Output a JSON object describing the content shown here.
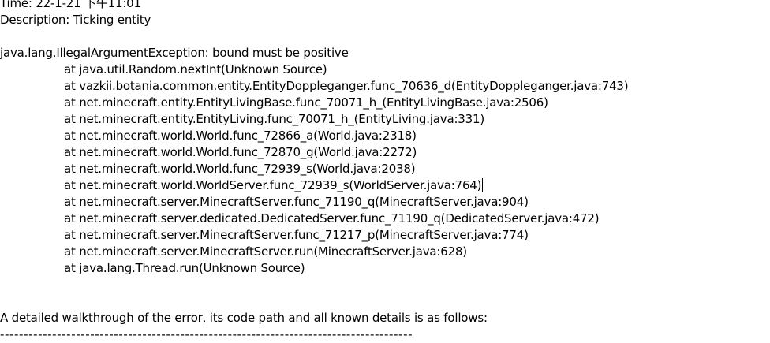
{
  "header": {
    "time": "Time: 22-1-21 下午11:01",
    "description": "Description: Ticking entity"
  },
  "exception": {
    "message": "java.lang.IllegalArgumentException: bound must be positive",
    "stack": [
      "at java.util.Random.nextInt(Unknown Source)",
      "at vazkii.botania.common.entity.EntityDoppleganger.func_70636_d(EntityDoppleganger.java:743)",
      "at net.minecraft.entity.EntityLivingBase.func_70071_h_(EntityLivingBase.java:2506)",
      "at net.minecraft.entity.EntityLiving.func_70071_h_(EntityLiving.java:331)",
      "at net.minecraft.world.World.func_72866_a(World.java:2318)",
      "at net.minecraft.world.World.func_72870_g(World.java:2272)",
      "at net.minecraft.world.World.func_72939_s(World.java:2038)",
      "at net.minecraft.world.WorldServer.func_72939_s(WorldServer.java:764)",
      "at net.minecraft.server.MinecraftServer.func_71190_q(MinecraftServer.java:904)",
      "at net.minecraft.server.dedicated.DedicatedServer.func_71190_q(DedicatedServer.java:472)",
      "at net.minecraft.server.MinecraftServer.func_71217_p(MinecraftServer.java:774)",
      "at net.minecraft.server.MinecraftServer.run(MinecraftServer.java:628)",
      "at java.lang.Thread.run(Unknown Source)"
    ]
  },
  "footer": {
    "walkthrough": "A detailed walkthrough of the error, its code path and all known details is as follows:",
    "divider": "---------------------------------------------------------------------------------------"
  }
}
